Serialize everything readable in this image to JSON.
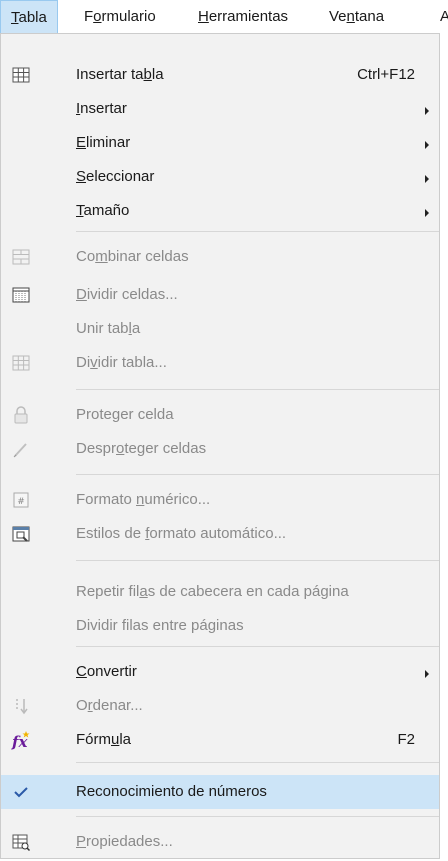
{
  "menubar": {
    "items": [
      {
        "label": "Tabla",
        "mnemonic": "T"
      },
      {
        "label": "Formulario",
        "mnemonic": "o"
      },
      {
        "label": "Herramientas",
        "mnemonic": "H"
      },
      {
        "label": "Ventana",
        "mnemonic": "n"
      },
      {
        "label": "A",
        "mnemonic": ""
      }
    ]
  },
  "dropdown": {
    "items": [
      {
        "label": "Insertar tabla",
        "shortcut": "Ctrl+F12",
        "icon": "table-insert-icon"
      },
      {
        "label": "Insertar",
        "submenu": true
      },
      {
        "label": "Eliminar",
        "submenu": true
      },
      {
        "label": "Seleccionar",
        "submenu": true
      },
      {
        "label": "Tamaño",
        "submenu": true
      },
      {
        "label": "Combinar celdas",
        "disabled": true,
        "icon": "merge-cells-icon"
      },
      {
        "label": "Dividir celdas...",
        "disabled": true,
        "icon": "split-cells-icon"
      },
      {
        "label": "Unir tabla",
        "disabled": true
      },
      {
        "label": "Dividir tabla...",
        "disabled": true,
        "icon": "split-table-icon"
      },
      {
        "label": "Proteger celda",
        "disabled": true,
        "icon": "lock-icon"
      },
      {
        "label": "Desproteger celdas",
        "disabled": true,
        "icon": "pencil-icon"
      },
      {
        "label": "Formato numérico...",
        "disabled": true,
        "icon": "number-format-icon"
      },
      {
        "label": "Estilos de formato automático...",
        "disabled": true,
        "icon": "autoformat-icon"
      },
      {
        "label": "Repetir filas de cabecera en cada página",
        "disabled": true
      },
      {
        "label": "Dividir filas entre páginas",
        "disabled": true
      },
      {
        "label": "Convertir",
        "submenu": true
      },
      {
        "label": "Ordenar...",
        "disabled": true,
        "icon": "sort-icon"
      },
      {
        "label": "Fórmula",
        "shortcut": "F2",
        "icon": "formula-icon"
      },
      {
        "label": "Reconocimiento de números",
        "checked": true,
        "icon": "checkmark-icon"
      },
      {
        "label": "Propiedades...",
        "disabled": true,
        "icon": "table-properties-icon"
      }
    ]
  }
}
